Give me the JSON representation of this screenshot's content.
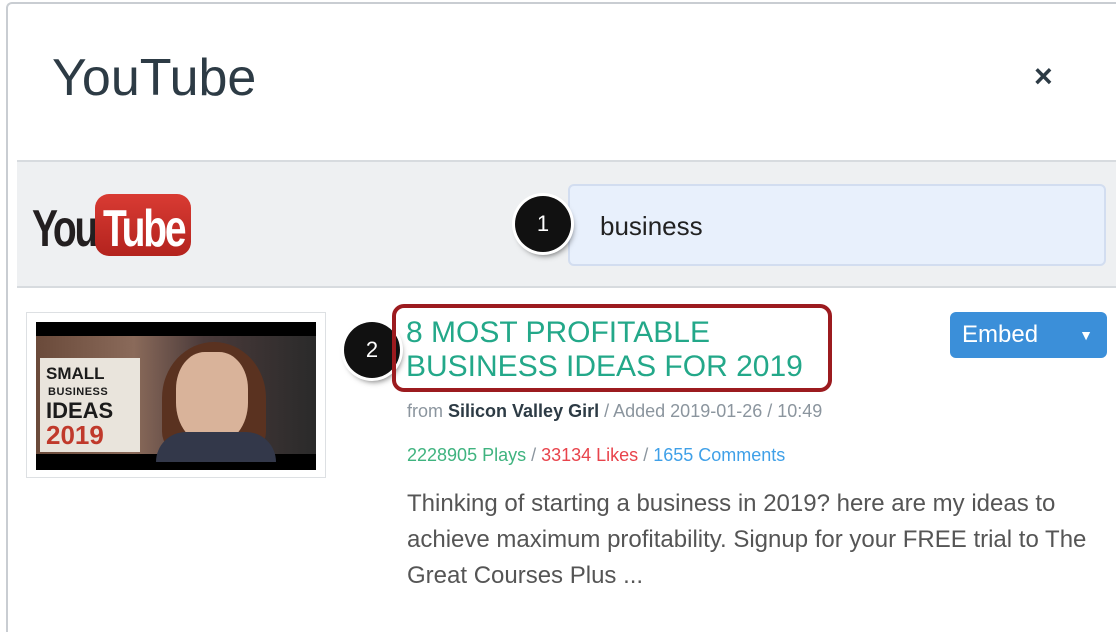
{
  "dialog": {
    "title": "YouTube",
    "close_label": "×"
  },
  "logo": {
    "you": "You",
    "tube": "Tube"
  },
  "search": {
    "value": "business"
  },
  "callouts": [
    "1",
    "2"
  ],
  "result": {
    "thumbnail": {
      "small": "SMALL",
      "business": "BUSINESS",
      "ideas": "IDEAS",
      "year": "2019"
    },
    "title": "8 MOST PROFITABLE BUSINESS IDEAS FOR 2019",
    "embed_label": "Embed",
    "embed_caret": "▼",
    "from_prefix": "from",
    "channel": "Silicon Valley Girl",
    "added": "/ Added 2019-01-26 / 10:49",
    "plays": "2228905 Plays",
    "sep1": " / ",
    "likes": "33134 Likes",
    "sep2": " / ",
    "comments": "1655 Comments",
    "description": "Thinking of starting a business in 2019? here are my ideas to achieve maximum profitability. Signup for your FREE trial to The Great Courses Plus ..."
  },
  "colors": {
    "title_green": "#23a889",
    "callout_box": "#9c1b1f",
    "embed_blue": "#3b8fd9"
  }
}
